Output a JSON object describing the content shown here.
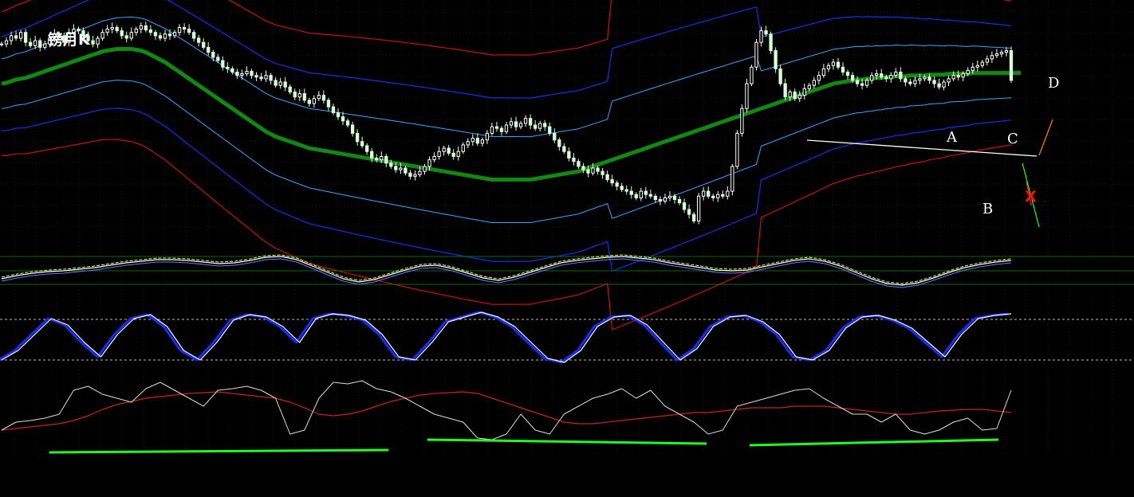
{
  "title": "镑月K",
  "colors": {
    "background": "#000000",
    "grid": "#1a1a1a",
    "candle_up": "#ffffff",
    "candle_down": "#d8ffd8",
    "middle_band": "#118811",
    "inner_band": "#33aaff",
    "mid_band": "#1133ee",
    "outer_band": "#cc1111",
    "trend_line": "#ffffff",
    "green_line": "#22ff22",
    "red_line": "#ff2222",
    "orange_line": "#ff8800",
    "oscillator_white": "#ffffff",
    "oscillator_blue": "#1a2bff",
    "index_red": "#cc2222"
  },
  "annotations": {
    "a": "A",
    "b": "B",
    "c": "C",
    "d": "D",
    "x": "X"
  },
  "chart_data": [
    {
      "type": "line",
      "panel": "price",
      "description_series": [
        "candlesticks",
        "band-middle",
        "band-inner-upper",
        "band-inner-lower",
        "band-mid-upper",
        "band-mid-lower",
        "band-outer-upper",
        "band-outer-lower"
      ],
      "x": [
        0,
        1,
        2,
        3,
        4,
        5,
        6,
        7,
        8,
        9,
        10,
        11,
        12,
        13,
        14,
        15,
        16,
        17,
        18,
        19,
        20,
        21,
        22,
        23,
        24,
        25,
        26,
        27,
        28,
        29,
        30,
        31,
        32,
        33,
        34,
        35,
        36,
        37,
        38,
        39,
        40,
        41,
        42,
        43,
        44,
        45,
        46,
        47,
        48,
        49,
        50,
        51,
        52,
        53,
        54,
        55,
        56,
        57,
        58,
        59,
        60,
        61,
        62,
        63,
        64,
        65,
        66,
        67,
        68,
        69,
        70,
        71,
        72,
        73,
        74,
        75,
        76,
        77,
        78,
        79,
        80,
        81,
        82,
        83,
        84,
        85,
        86,
        87,
        88,
        89,
        90,
        91,
        92,
        93,
        94,
        95,
        96,
        97,
        98,
        99,
        100,
        101,
        102,
        103,
        104,
        105,
        106,
        107,
        108,
        109,
        110,
        111,
        112,
        113,
        114,
        115,
        116,
        117,
        118,
        119,
        120,
        121,
        122,
        123,
        124,
        125,
        126,
        127,
        128,
        129,
        130,
        131,
        132,
        133,
        134,
        135,
        136,
        137,
        138,
        139,
        140,
        141,
        142,
        143,
        144,
        145,
        146,
        147,
        148,
        149,
        150,
        151,
        152,
        153,
        154,
        155,
        156,
        157,
        158,
        159,
        160,
        161,
        162,
        163,
        164,
        165,
        166,
        167,
        168,
        169,
        170,
        171,
        172,
        173,
        174,
        175,
        176,
        177,
        178,
        179,
        180,
        181,
        182,
        183,
        184,
        185,
        186,
        187,
        188,
        189,
        190,
        191,
        192,
        193,
        194,
        195,
        196,
        197,
        198,
        199,
        200,
        201,
        202,
        203,
        204,
        205,
        206,
        207,
        208,
        209,
        210
      ],
      "close": [
        248,
        252,
        258,
        255,
        262,
        250,
        246,
        252,
        244,
        248,
        255,
        260,
        258,
        250,
        262,
        266,
        264,
        258,
        252,
        248,
        255,
        262,
        266,
        268,
        264,
        258,
        255,
        262,
        266,
        270,
        265,
        262,
        258,
        255,
        260,
        258,
        262,
        268,
        266,
        262,
        255,
        250,
        244,
        238,
        232,
        228,
        220,
        218,
        214,
        210,
        212,
        215,
        210,
        208,
        206,
        210,
        204,
        198,
        202,
        196,
        190,
        184,
        188,
        180,
        176,
        182,
        186,
        180,
        172,
        165,
        160,
        155,
        150,
        140,
        130,
        125,
        118,
        110,
        108,
        112,
        104,
        100,
        96,
        98,
        92,
        88,
        90,
        94,
        100,
        108,
        112,
        118,
        122,
        116,
        112,
        118,
        126,
        130,
        134,
        128,
        132,
        140,
        148,
        146,
        142,
        150,
        154,
        148,
        152,
        158,
        150,
        146,
        152,
        148,
        140,
        132,
        124,
        118,
        110,
        106,
        100,
        96,
        92,
        98,
        94,
        90,
        84,
        80,
        76,
        72,
        70,
        66,
        62,
        70,
        66,
        64,
        60,
        58,
        62,
        64,
        60,
        56,
        48,
        42,
        34,
        64,
        70,
        64,
        62,
        66,
        64,
        70,
        100,
        140,
        170,
        200,
        220,
        250,
        264,
        260,
        240,
        218,
        200,
        184,
        190,
        182,
        186,
        194,
        198,
        204,
        210,
        218,
        222,
        226,
        220,
        214,
        210,
        204,
        200,
        198,
        204,
        210,
        212,
        208,
        206,
        210,
        214,
        206,
        202,
        200,
        204,
        206,
        208,
        204,
        200,
        196,
        202,
        206,
        210,
        208,
        212,
        216,
        220,
        222,
        226,
        230,
        234,
        236,
        238,
        240,
        204
      ],
      "band_middle": [
        200,
        201,
        203,
        205,
        206,
        207,
        209,
        211,
        213,
        215,
        217,
        219,
        221,
        223,
        225,
        227,
        229,
        231,
        233,
        235,
        237,
        239,
        240,
        241,
        242,
        242,
        242,
        242,
        241,
        240,
        238,
        235,
        232,
        229,
        226,
        222,
        218,
        214,
        210,
        206,
        202,
        198,
        194,
        190,
        186,
        182,
        178,
        174,
        170,
        166,
        162,
        158,
        154,
        150,
        146,
        142,
        139,
        136,
        134,
        132,
        130,
        128,
        126,
        124,
        122,
        121,
        120,
        119,
        118,
        117,
        116,
        115,
        114,
        113,
        112,
        111,
        110,
        109,
        108,
        107,
        106,
        105,
        104,
        103,
        102,
        101,
        100,
        99,
        98,
        97,
        96,
        95,
        94,
        93,
        92,
        91,
        90,
        89,
        88,
        87,
        86,
        85,
        84,
        84,
        84,
        84,
        84,
        84,
        84,
        84,
        84,
        85,
        86,
        87,
        88,
        89,
        90,
        91,
        92,
        93,
        94,
        96,
        98,
        100,
        102,
        104,
        106,
        108,
        110,
        112,
        114,
        116,
        118,
        120,
        122,
        124,
        126,
        128,
        130,
        132,
        134,
        136,
        138,
        140,
        142,
        144,
        146,
        148,
        150,
        152,
        154,
        156,
        158,
        160,
        162,
        164,
        166,
        168,
        170,
        172,
        174,
        176,
        178,
        180,
        182,
        184,
        186,
        188,
        190,
        192,
        194,
        196,
        198,
        200,
        201,
        202,
        203,
        204,
        205,
        205,
        206,
        206,
        207,
        207,
        208,
        208,
        209,
        209,
        209,
        210,
        210,
        210,
        210,
        211,
        211,
        211,
        211,
        212,
        212,
        212,
        212,
        212,
        213,
        213,
        213,
        213,
        213,
        213,
        213,
        213,
        213,
        213,
        213
      ]
    },
    {
      "type": "line",
      "panel": "oscillator-1",
      "series": [
        {
          "values": [
            350,
            346,
            343,
            341,
            340,
            338,
            336,
            333,
            330,
            328,
            326,
            326,
            327,
            329,
            331,
            330,
            327,
            323,
            322,
            326,
            334,
            342,
            350,
            354,
            351,
            345,
            339,
            334,
            333,
            337,
            343,
            349,
            352,
            348,
            342,
            336,
            330,
            327,
            325,
            323,
            322,
            324,
            326,
            330,
            333,
            336,
            339,
            340,
            339,
            335,
            331,
            327,
            325,
            328,
            334,
            342,
            350,
            356,
            358,
            355,
            349,
            342,
            336,
            332,
            329,
            327
          ]
        }
      ]
    },
    {
      "type": "line",
      "panel": "oscillator-2",
      "series": [
        {
          "values": [
            452,
            440,
            420,
            400,
            408,
            430,
            448,
            420,
            400,
            395,
            410,
            440,
            452,
            430,
            402,
            395,
            398,
            410,
            430,
            400,
            394,
            396,
            402,
            420,
            448,
            452,
            430,
            404,
            398,
            392,
            398,
            410,
            430,
            450,
            455,
            440,
            410,
            398,
            396,
            408,
            430,
            452,
            438,
            410,
            398,
            396,
            404,
            420,
            448,
            452,
            440,
            412,
            398,
            396,
            402,
            412,
            430,
            448,
            420,
            400,
            396,
            394
          ]
        }
      ]
    },
    {
      "type": "line",
      "panel": "index",
      "series": [
        {
          "values": [
            540,
            530,
            528,
            525,
            520,
            490,
            485,
            495,
            500,
            505,
            488,
            480,
            490,
            500,
            510,
            490,
            488,
            485,
            490,
            500,
            545,
            540,
            500,
            480,
            482,
            478,
            488,
            492,
            500,
            510,
            520,
            525,
            530,
            550,
            552,
            545,
            520,
            540,
            545,
            520,
            510,
            500,
            495,
            488,
            500,
            490,
            510,
            520,
            530,
            545,
            540,
            510,
            505,
            500,
            495,
            490,
            488,
            500,
            510,
            520,
            520,
            530,
            520,
            540,
            545,
            540,
            530,
            525,
            540,
            538,
            490
          ]
        },
        {
          "values": [
            540,
            538,
            536,
            534,
            532,
            528,
            522,
            514,
            508,
            504,
            500,
            498,
            496,
            494,
            493,
            492,
            494,
            496,
            498,
            500,
            505,
            512,
            520,
            522,
            520,
            516,
            510,
            504,
            500,
            496,
            494,
            493,
            492,
            494,
            500,
            506,
            512,
            518,
            524,
            530,
            532,
            532,
            530,
            528,
            526,
            524,
            522,
            520,
            518,
            518,
            516,
            514,
            512,
            512,
            512,
            510,
            510,
            510,
            512,
            514,
            516,
            518,
            520,
            520,
            518,
            516,
            515,
            514,
            514,
            516,
            518
          ]
        }
      ]
    }
  ]
}
